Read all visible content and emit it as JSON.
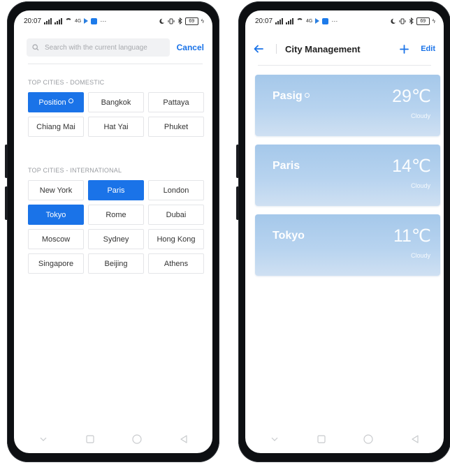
{
  "status_bar": {
    "time": "20:07",
    "net_text": "4G",
    "battery": "69"
  },
  "search_screen": {
    "search": {
      "placeholder": "Search with the current language",
      "value": ""
    },
    "cancel_label": "Cancel",
    "domestic": {
      "title": "TOP CITIES - DOMESTIC",
      "cities": [
        {
          "name": "Position",
          "active": true,
          "has_pin": true
        },
        {
          "name": "Bangkok",
          "active": false
        },
        {
          "name": "Pattaya",
          "active": false
        },
        {
          "name": "Chiang Mai",
          "active": false
        },
        {
          "name": "Hat Yai",
          "active": false
        },
        {
          "name": "Phuket",
          "active": false
        }
      ]
    },
    "international": {
      "title": "TOP CITIES - INTERNATIONAL",
      "cities": [
        {
          "name": "New York",
          "active": false
        },
        {
          "name": "Paris",
          "active": true
        },
        {
          "name": "London",
          "active": false
        },
        {
          "name": "Tokyo",
          "active": true
        },
        {
          "name": "Rome",
          "active": false
        },
        {
          "name": "Dubai",
          "active": false
        },
        {
          "name": "Moscow",
          "active": false
        },
        {
          "name": "Sydney",
          "active": false
        },
        {
          "name": "Hong Kong",
          "active": false
        },
        {
          "name": "Singapore",
          "active": false
        },
        {
          "name": "Beijing",
          "active": false
        },
        {
          "name": "Athens",
          "active": false
        }
      ]
    }
  },
  "city_management": {
    "title": "City Management",
    "edit_label": "Edit",
    "cards": [
      {
        "city": "Pasig",
        "has_pin": true,
        "temp": "29℃",
        "condition": "Cloudy"
      },
      {
        "city": "Paris",
        "has_pin": false,
        "temp": "14℃",
        "condition": "Cloudy"
      },
      {
        "city": "Tokyo",
        "has_pin": false,
        "temp": "11℃",
        "condition": "Cloudy"
      }
    ]
  },
  "colors": {
    "accent": "#1a73e8",
    "card_top": "#a5c8ea",
    "card_bottom": "#cfe0f2",
    "frame": "#0d0f12"
  },
  "icons": {
    "search": "search-icon",
    "back": "arrow-left-icon",
    "add": "plus-icon",
    "location": "location-pin-icon",
    "nav": [
      "chevron-down-icon",
      "square-icon",
      "circle-icon",
      "triangle-back-icon"
    ]
  }
}
